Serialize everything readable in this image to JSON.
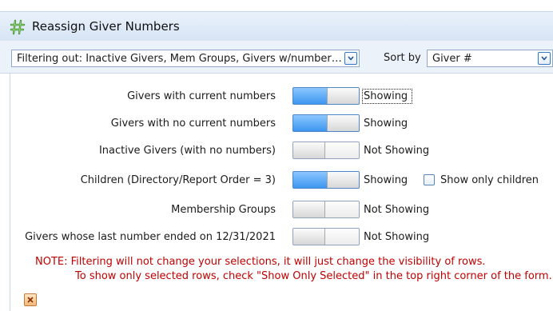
{
  "window": {
    "title": "Reassign Giver Numbers",
    "icon": "hash-icon"
  },
  "filter": {
    "value": "Filtering out: Inactive Givers, Mem Groups, Givers w/number…",
    "sort_label": "Sort by",
    "sort_value": "Giver #"
  },
  "rows": [
    {
      "label": "Givers with current numbers",
      "on": true,
      "status": "Showing"
    },
    {
      "label": "Givers with no current numbers",
      "on": true,
      "status": "Showing"
    },
    {
      "label": "Inactive Givers (with no numbers)",
      "on": false,
      "status": "Not Showing"
    },
    {
      "label": "Children (Directory/Report Order = 3)",
      "on": true,
      "status": "Showing"
    },
    {
      "label": "Membership Groups",
      "on": false,
      "status": "Not Showing"
    },
    {
      "label": "Givers whose last number ended on 12/31/2021",
      "on": false,
      "status": "Not Showing"
    }
  ],
  "children_only": {
    "label": "Show only children",
    "checked": false
  },
  "note": {
    "line1": "NOTE:  Filtering will not change your selections, it will just change the visibility of rows.",
    "line2": "To show only selected rows, check \"Show Only Selected\" in the top right corner of the form."
  },
  "colors": {
    "note": "#c00000",
    "toggle_on": "#3d97f0",
    "accent": "#2e7ac9"
  }
}
